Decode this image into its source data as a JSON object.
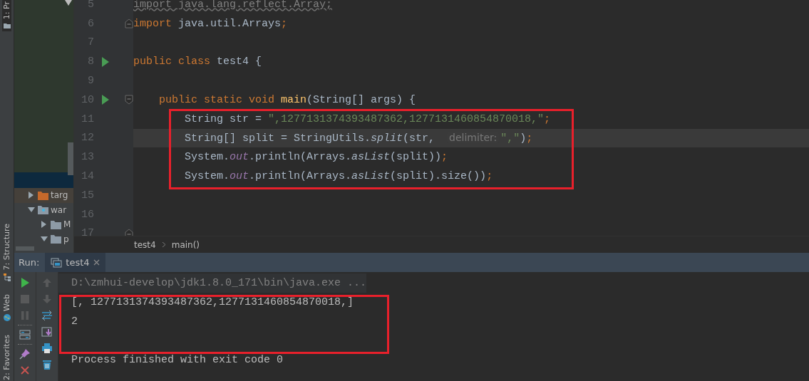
{
  "tool_strip": [
    {
      "label": "1: Pr",
      "selected": true,
      "kind": "project"
    },
    {
      "label": "7: Structure",
      "selected": false,
      "kind": "structure"
    },
    {
      "label": "Web",
      "selected": false,
      "kind": "web"
    },
    {
      "label": "2: Favorites",
      "selected": false,
      "kind": "favorites"
    }
  ],
  "project_tree": [
    {
      "label": "targ",
      "kind": "excluded",
      "expanded": false
    },
    {
      "label": "war",
      "kind": "module",
      "expanded": true,
      "children": [
        {
          "label": "M",
          "kind": "plain",
          "expanded": false
        },
        {
          "label": "p",
          "kind": "plain",
          "expanded": true
        }
      ]
    }
  ],
  "editor": {
    "lines": [
      {
        "number": "5",
        "current": false,
        "annotated": false,
        "segments": [
          {
            "text": "import java.lang.reflect.Array;",
            "kind": "unused"
          }
        ]
      },
      {
        "number": "6",
        "current": false,
        "annotated": false,
        "fold": {
          "kind": "end"
        },
        "segments": [
          {
            "text": "import",
            "kind": "keyword"
          },
          {
            "text": " java.util.Arrays",
            "kind": "plain"
          },
          {
            "text": ";",
            "kind": "keyword"
          }
        ]
      },
      {
        "number": "7",
        "current": false,
        "annotated": false
      },
      {
        "number": "8",
        "current": false,
        "annotated": false,
        "runnable": true,
        "segments": [
          {
            "text": "public class",
            "kind": "keyword"
          },
          {
            "text": " test4 {",
            "kind": "plain"
          }
        ]
      },
      {
        "number": "9",
        "current": false,
        "annotated": false
      },
      {
        "number": "10",
        "current": false,
        "annotated": false,
        "runnable": true,
        "fold": {
          "kind": "start"
        },
        "segments": [
          {
            "text": "    public static void ",
            "kind": "keyword"
          },
          {
            "text": "main",
            "kind": "declaration"
          },
          {
            "text": "(String[] args) {",
            "kind": "plain"
          }
        ]
      },
      {
        "number": "11",
        "current": false,
        "annotated": true,
        "segments": [
          {
            "text": "        String str = ",
            "kind": "plain"
          },
          {
            "text": "\",1277131374393487362,1277131460854870018,\"",
            "kind": "string"
          },
          {
            "text": ";",
            "kind": "keyword"
          }
        ]
      },
      {
        "number": "12",
        "current": true,
        "annotated": true,
        "segments": [
          {
            "text": "        String[] split = StringUtils.",
            "kind": "plain"
          },
          {
            "text": "split",
            "kind": "call"
          },
          {
            "text": "(str, ",
            "kind": "plain"
          },
          {
            "text": "delimiter:",
            "kind": "hint"
          },
          {
            "text": "\",\"",
            "kind": "string"
          },
          {
            "text": ")",
            "kind": "plain"
          },
          {
            "text": ";",
            "kind": "keyword"
          }
        ]
      },
      {
        "number": "13",
        "current": false,
        "annotated": true,
        "segments": [
          {
            "text": "        System.",
            "kind": "plain"
          },
          {
            "text": "out",
            "kind": "static"
          },
          {
            "text": ".println(Arrays.",
            "kind": "plain"
          },
          {
            "text": "asList",
            "kind": "call"
          },
          {
            "text": "(split))",
            "kind": "plain"
          },
          {
            "text": ";",
            "kind": "keyword"
          }
        ]
      },
      {
        "number": "14",
        "current": false,
        "annotated": true,
        "segments": [
          {
            "text": "        System.",
            "kind": "plain"
          },
          {
            "text": "out",
            "kind": "static"
          },
          {
            "text": ".println(Arrays.",
            "kind": "plain"
          },
          {
            "text": "asList",
            "kind": "call"
          },
          {
            "text": "(split).size())",
            "kind": "plain"
          },
          {
            "text": ";",
            "kind": "keyword"
          }
        ]
      },
      {
        "number": "15",
        "current": false,
        "annotated": false
      },
      {
        "number": "16",
        "current": false,
        "annotated": false
      },
      {
        "number": "17",
        "current": false,
        "annotated": false,
        "fold": {
          "kind": "end"
        }
      }
    ]
  },
  "breadcrumb": [
    "test4",
    "main()"
  ],
  "run_panel": {
    "label": "Run:",
    "tab": "test4",
    "primary_tools": [
      {
        "kind": "run",
        "disabled": false
      },
      {
        "kind": "stop",
        "disabled": true
      },
      {
        "kind": "pause",
        "disabled": true
      },
      {
        "kind": "separator"
      },
      {
        "kind": "layout",
        "disabled": false
      },
      {
        "kind": "separator"
      },
      {
        "kind": "pin",
        "disabled": false
      },
      {
        "kind": "close",
        "disabled": false
      }
    ],
    "secondary_tools": [
      {
        "kind": "up",
        "disabled": true
      },
      {
        "kind": "down",
        "disabled": true
      },
      {
        "kind": "wrap",
        "disabled": false
      },
      {
        "kind": "scroll-end",
        "disabled": false
      },
      {
        "kind": "print",
        "disabled": false
      },
      {
        "kind": "trash",
        "disabled": false
      }
    ],
    "console": [
      {
        "text": "D:\\zmhui-develop\\jdk1.8.0_171\\bin\\java.exe ...",
        "kind": "command",
        "annotated": false
      },
      {
        "text": "[, 1277131374393487362,1277131460854870018,]",
        "kind": "output",
        "annotated": true
      },
      {
        "text": "2",
        "kind": "output",
        "annotated": true
      },
      {
        "text": "Process finished with exit code 0",
        "kind": "exit",
        "annotated": false
      }
    ]
  }
}
